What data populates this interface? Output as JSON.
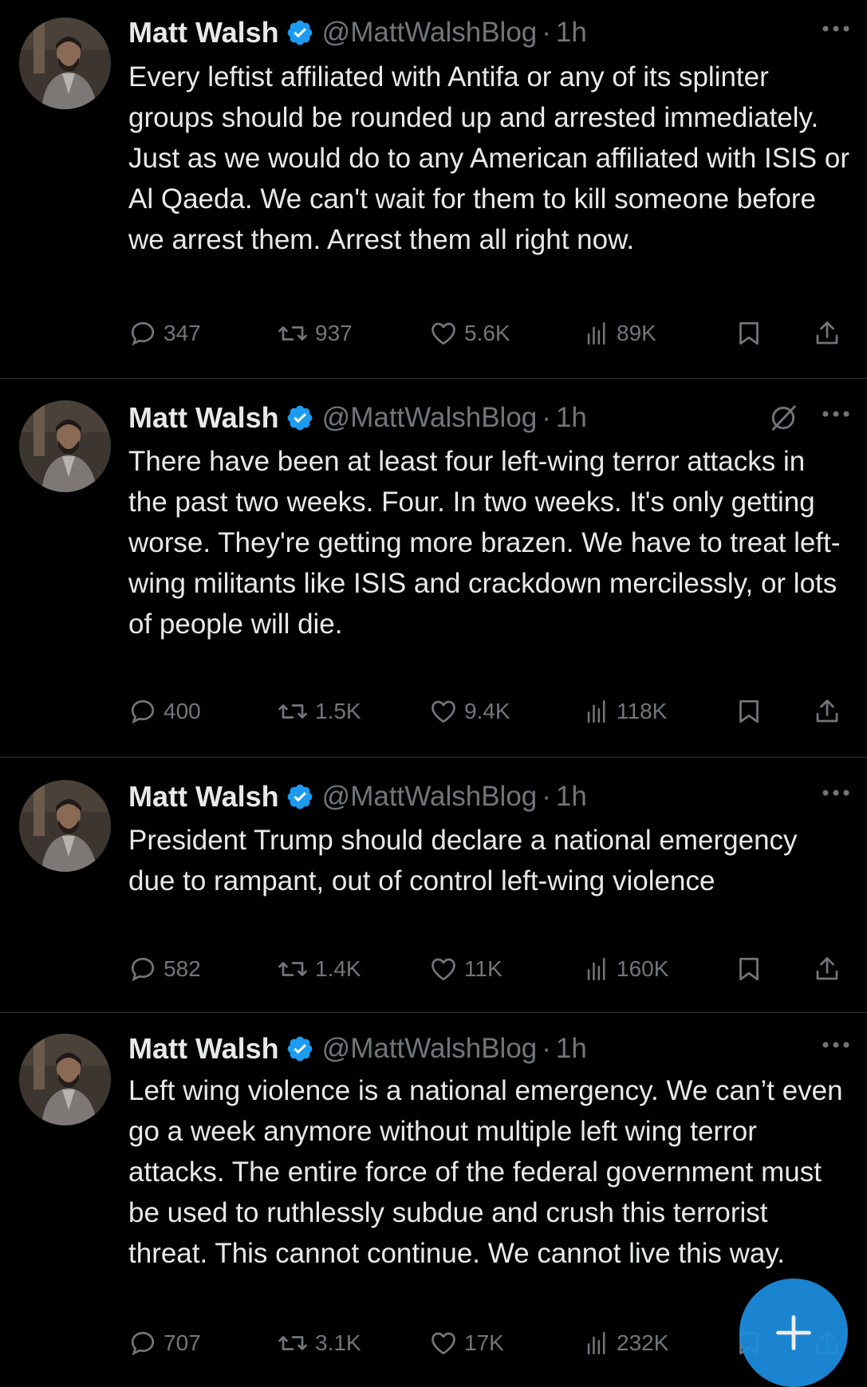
{
  "tweets": [
    {
      "author": "Matt Walsh",
      "handle": "@MattWalshBlog",
      "separator": "·",
      "time": "1h",
      "text": "Every leftist affiliated with Antifa or any of its splinter groups should be rounded up and arrested immediately. Just as we would do to any American affiliated with ISIS or Al Qaeda. We can't wait for them to kill someone before we arrest them. Arrest them all right now.",
      "replies": "347",
      "reposts": "937",
      "likes": "5.6K",
      "views": "89K",
      "has_grok_icon": false
    },
    {
      "author": "Matt Walsh",
      "handle": "@MattWalshBlog",
      "separator": "·",
      "time": "1h",
      "text": "There have been at least four left-wing terror attacks in the past two weeks. Four. In two weeks. It's only getting worse. They're getting more brazen. We have to treat left-wing militants like ISIS and crackdown mercilessly, or lots of people will die.",
      "replies": "400",
      "reposts": "1.5K",
      "likes": "9.4K",
      "views": "118K",
      "has_grok_icon": true
    },
    {
      "author": "Matt Walsh",
      "handle": "@MattWalshBlog",
      "separator": "·",
      "time": "1h",
      "text": "President Trump should declare a national emergency due to rampant, out of control left-wing violence",
      "replies": "582",
      "reposts": "1.4K",
      "likes": "11K",
      "views": "160K",
      "has_grok_icon": false
    },
    {
      "author": "Matt Walsh",
      "handle": "@MattWalshBlog",
      "separator": "·",
      "time": "1h",
      "text": "Left wing violence is a national emergency. We can’t even go a week anymore without multiple left wing terror attacks. The entire force of the federal government must be used to ruthlessly subdue and crush this terrorist threat. This cannot continue. We cannot live this way.",
      "replies": "707",
      "reposts": "3.1K",
      "likes": "17K",
      "views": "232K",
      "has_grok_icon": false
    }
  ],
  "icons": {
    "verified": "verified-badge-icon",
    "more": "more-options-icon",
    "grok": "grok-icon",
    "reply": "reply-icon",
    "repost": "repost-icon",
    "like": "like-icon",
    "views": "views-icon",
    "bookmark": "bookmark-icon",
    "share": "share-icon",
    "compose": "plus-icon"
  },
  "colors": {
    "background": "#000000",
    "text": "#e7e9ea",
    "secondary": "#71767b",
    "divider": "#2f3336",
    "verified": "#1d9bf0",
    "fab": "#1d8fe0"
  }
}
